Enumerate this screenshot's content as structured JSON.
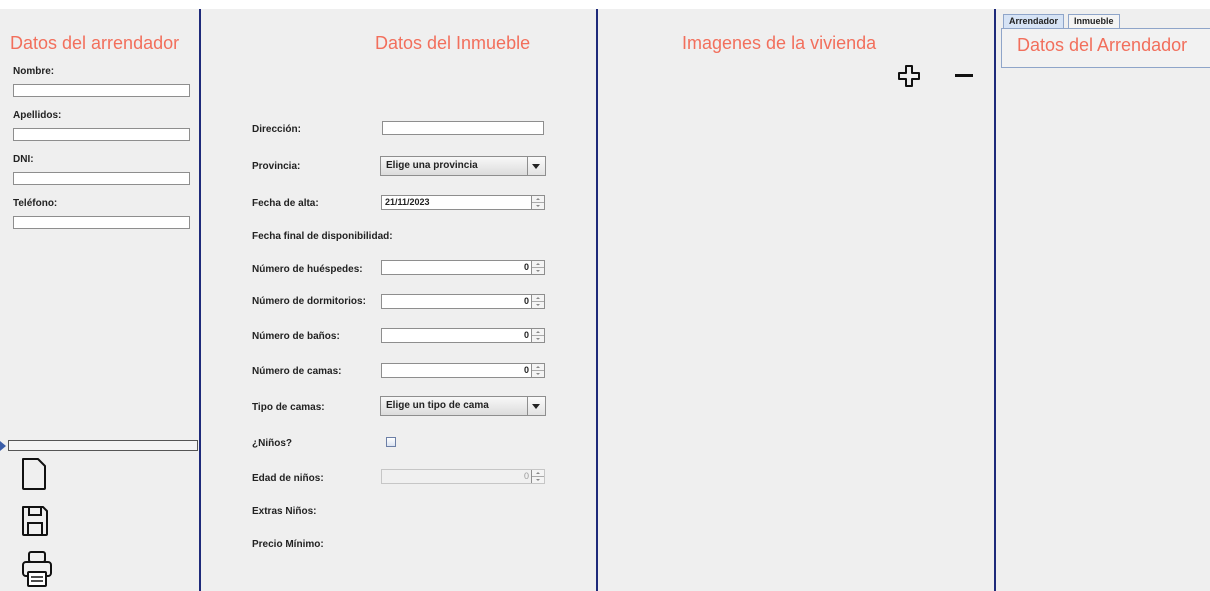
{
  "arrendador": {
    "title": "Datos del arrendador",
    "fields": [
      {
        "label": "Nombre:",
        "value": ""
      },
      {
        "label": "Apellidos:",
        "value": ""
      },
      {
        "label": "DNI:",
        "value": ""
      },
      {
        "label": "Teléfono:",
        "value": ""
      }
    ],
    "toolbar_icons": [
      "new-file-icon",
      "save-icon",
      "print-icon"
    ]
  },
  "inmueble": {
    "title": "Datos del Inmueble",
    "direccion": {
      "label": "Dirección:",
      "value": ""
    },
    "provincia": {
      "label": "Provincia:",
      "value": "Elige una provincia"
    },
    "fecha_alta": {
      "label": "Fecha de alta:",
      "value": "21/11/2023"
    },
    "fecha_final": {
      "label": "Fecha final de disponibilidad:"
    },
    "huespedes": {
      "label": "Número de huéspedes:",
      "value": "0"
    },
    "dormitorios": {
      "label": "Número de dormitorios:",
      "value": "0"
    },
    "banos": {
      "label": "Número de baños:",
      "value": "0"
    },
    "camas": {
      "label": "Número de camas:",
      "value": "0"
    },
    "tipo_camas": {
      "label": "Tipo de camas:",
      "value": "Elige un tipo de cama"
    },
    "ninos": {
      "label": "¿Niños?",
      "checked": false
    },
    "edad_ninos": {
      "label": "Edad de niños:",
      "value": "0"
    },
    "extras_ninos": {
      "label": "Extras Niños:"
    },
    "precio_minimo": {
      "label": "Precio Mínimo:"
    }
  },
  "imagenes": {
    "title": "Imagenes de la vivienda",
    "add_icon": "plus-icon",
    "remove_icon": "minus-icon"
  },
  "resumen": {
    "tabs": [
      {
        "label": "Arrendador",
        "active": true
      },
      {
        "label": "Inmueble",
        "active": false
      }
    ],
    "title": "Datos del Arrendador"
  },
  "colors": {
    "heading": "#f26f5c",
    "divider": "#1e2a7a",
    "background": "#efefef"
  }
}
